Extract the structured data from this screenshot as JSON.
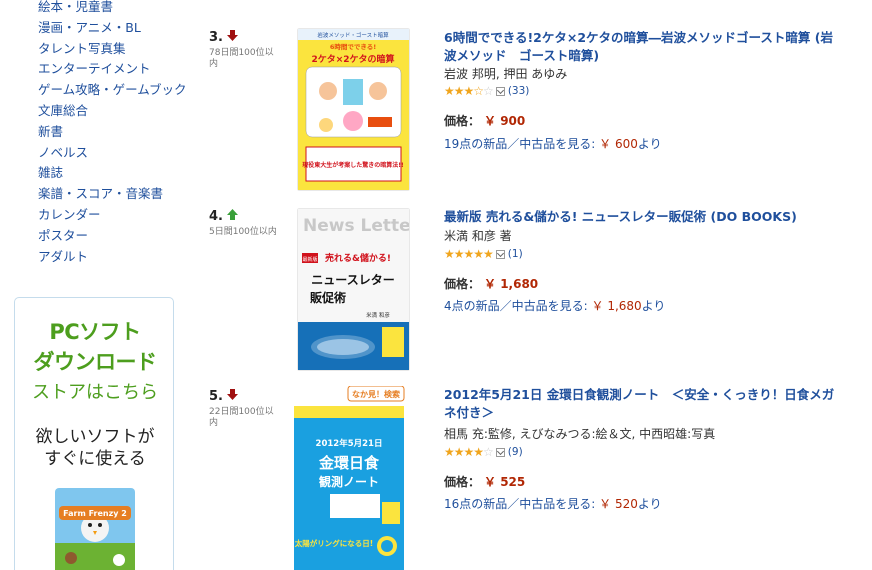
{
  "categories": [
    "絵本・児童書",
    "漫画・アニメ・BL",
    "タレント写真集",
    "エンターテイメント",
    "ゲーム攻略・ゲームブック",
    "文庫総合",
    "新書",
    "ノベルス",
    "雑誌",
    "楽譜・スコア・音楽書",
    "カレンダー",
    "ポスター",
    "アダルト"
  ],
  "ad": {
    "line1": "PCソフト",
    "line2": "ダウンロード",
    "line3": "ストアはこちら",
    "sub1": "欲しいソフトが",
    "sub2": "すぐに使える",
    "game_logo": "Farm Frenzy 2"
  },
  "colors": {
    "link": "#1f4f9c",
    "price": "#b12704",
    "accent_green": "#4d9e1e",
    "up": "#3aa03a",
    "down": "#a01010"
  },
  "items": [
    {
      "rank": "3.",
      "trend": "down",
      "days": "78日間100位以内",
      "title": "6時間でできる!2ケタ×2ケタの暗算―岩波メソッドゴースト暗算 (岩波メソッド　ゴースト暗算)",
      "author": "岩波 邦明, 押田 あゆみ",
      "rating": 3.5,
      "reviews": "(33)",
      "price_label": "価格：",
      "price": "￥ 900",
      "offers_text": "19点の新品／中古品を見る: ",
      "offers_price": "￥ 600",
      "offers_suffix": "より",
      "cover": {
        "header": "岩波メソッド・ゴースト暗算",
        "top": "6時間でできる!",
        "big": "2ケタ×2ケタの暗算",
        "slogan": "現役東大生が考案した驚きの暗算法!!"
      }
    },
    {
      "rank": "4.",
      "trend": "up",
      "days": "5日間100位以内",
      "title": "最新版 売れる&儲かる! ニュースレター販促術 (DO BOOKS)",
      "author": "米満 和彦 著",
      "rating": 5,
      "reviews": "(1)",
      "price_label": "価格：",
      "price": "￥ 1,680",
      "offers_text": "4点の新品／中古品を見る: ",
      "offers_price": "￥ 1,680",
      "offers_suffix": "より",
      "cover": {
        "header": "News Letter",
        "badge": "最新版",
        "top": "売れる&儲かる!",
        "big1": "ニュースレター",
        "big2": "販促術",
        "author": "米満 和彦"
      }
    },
    {
      "rank": "5.",
      "trend": "down",
      "days": "22日間100位以内",
      "title": "2012年5月21日 金環日食観測ノート　＜安全・くっきり！日食メガネ付き＞",
      "author": "相馬 充:監修, えびなみつる:絵＆文, 中西昭雄:写真",
      "rating": 4,
      "reviews": "(9)",
      "price_label": "価格：",
      "price": "￥ 525",
      "offers_text": "16点の新品／中古品を見る: ",
      "offers_price": "￥ 520",
      "offers_suffix": "より",
      "cover": {
        "peek": "なか見！検索",
        "date": "2012年5月21日",
        "big1": "金環日食",
        "big2": "観測ノート",
        "slogan": "太陽がリングになる日!"
      }
    }
  ]
}
